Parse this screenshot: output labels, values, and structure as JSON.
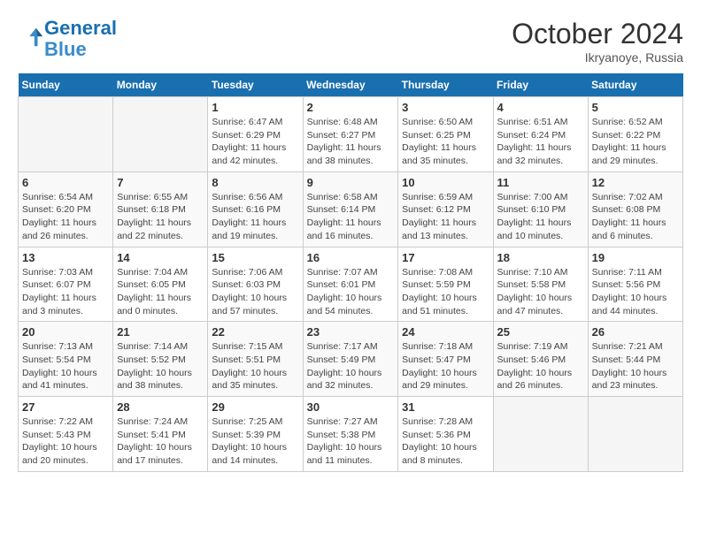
{
  "logo": {
    "line1": "General",
    "line2": "Blue"
  },
  "title": "October 2024",
  "location": "Ikryanoye, Russia",
  "days_header": [
    "Sunday",
    "Monday",
    "Tuesday",
    "Wednesday",
    "Thursday",
    "Friday",
    "Saturday"
  ],
  "weeks": [
    [
      {
        "day": "",
        "info": ""
      },
      {
        "day": "",
        "info": ""
      },
      {
        "day": "1",
        "info": "Sunrise: 6:47 AM\nSunset: 6:29 PM\nDaylight: 11 hours and 42 minutes."
      },
      {
        "day": "2",
        "info": "Sunrise: 6:48 AM\nSunset: 6:27 PM\nDaylight: 11 hours and 38 minutes."
      },
      {
        "day": "3",
        "info": "Sunrise: 6:50 AM\nSunset: 6:25 PM\nDaylight: 11 hours and 35 minutes."
      },
      {
        "day": "4",
        "info": "Sunrise: 6:51 AM\nSunset: 6:24 PM\nDaylight: 11 hours and 32 minutes."
      },
      {
        "day": "5",
        "info": "Sunrise: 6:52 AM\nSunset: 6:22 PM\nDaylight: 11 hours and 29 minutes."
      }
    ],
    [
      {
        "day": "6",
        "info": "Sunrise: 6:54 AM\nSunset: 6:20 PM\nDaylight: 11 hours and 26 minutes."
      },
      {
        "day": "7",
        "info": "Sunrise: 6:55 AM\nSunset: 6:18 PM\nDaylight: 11 hours and 22 minutes."
      },
      {
        "day": "8",
        "info": "Sunrise: 6:56 AM\nSunset: 6:16 PM\nDaylight: 11 hours and 19 minutes."
      },
      {
        "day": "9",
        "info": "Sunrise: 6:58 AM\nSunset: 6:14 PM\nDaylight: 11 hours and 16 minutes."
      },
      {
        "day": "10",
        "info": "Sunrise: 6:59 AM\nSunset: 6:12 PM\nDaylight: 11 hours and 13 minutes."
      },
      {
        "day": "11",
        "info": "Sunrise: 7:00 AM\nSunset: 6:10 PM\nDaylight: 11 hours and 10 minutes."
      },
      {
        "day": "12",
        "info": "Sunrise: 7:02 AM\nSunset: 6:08 PM\nDaylight: 11 hours and 6 minutes."
      }
    ],
    [
      {
        "day": "13",
        "info": "Sunrise: 7:03 AM\nSunset: 6:07 PM\nDaylight: 11 hours and 3 minutes."
      },
      {
        "day": "14",
        "info": "Sunrise: 7:04 AM\nSunset: 6:05 PM\nDaylight: 11 hours and 0 minutes."
      },
      {
        "day": "15",
        "info": "Sunrise: 7:06 AM\nSunset: 6:03 PM\nDaylight: 10 hours and 57 minutes."
      },
      {
        "day": "16",
        "info": "Sunrise: 7:07 AM\nSunset: 6:01 PM\nDaylight: 10 hours and 54 minutes."
      },
      {
        "day": "17",
        "info": "Sunrise: 7:08 AM\nSunset: 5:59 PM\nDaylight: 10 hours and 51 minutes."
      },
      {
        "day": "18",
        "info": "Sunrise: 7:10 AM\nSunset: 5:58 PM\nDaylight: 10 hours and 47 minutes."
      },
      {
        "day": "19",
        "info": "Sunrise: 7:11 AM\nSunset: 5:56 PM\nDaylight: 10 hours and 44 minutes."
      }
    ],
    [
      {
        "day": "20",
        "info": "Sunrise: 7:13 AM\nSunset: 5:54 PM\nDaylight: 10 hours and 41 minutes."
      },
      {
        "day": "21",
        "info": "Sunrise: 7:14 AM\nSunset: 5:52 PM\nDaylight: 10 hours and 38 minutes."
      },
      {
        "day": "22",
        "info": "Sunrise: 7:15 AM\nSunset: 5:51 PM\nDaylight: 10 hours and 35 minutes."
      },
      {
        "day": "23",
        "info": "Sunrise: 7:17 AM\nSunset: 5:49 PM\nDaylight: 10 hours and 32 minutes."
      },
      {
        "day": "24",
        "info": "Sunrise: 7:18 AM\nSunset: 5:47 PM\nDaylight: 10 hours and 29 minutes."
      },
      {
        "day": "25",
        "info": "Sunrise: 7:19 AM\nSunset: 5:46 PM\nDaylight: 10 hours and 26 minutes."
      },
      {
        "day": "26",
        "info": "Sunrise: 7:21 AM\nSunset: 5:44 PM\nDaylight: 10 hours and 23 minutes."
      }
    ],
    [
      {
        "day": "27",
        "info": "Sunrise: 7:22 AM\nSunset: 5:43 PM\nDaylight: 10 hours and 20 minutes."
      },
      {
        "day": "28",
        "info": "Sunrise: 7:24 AM\nSunset: 5:41 PM\nDaylight: 10 hours and 17 minutes."
      },
      {
        "day": "29",
        "info": "Sunrise: 7:25 AM\nSunset: 5:39 PM\nDaylight: 10 hours and 14 minutes."
      },
      {
        "day": "30",
        "info": "Sunrise: 7:27 AM\nSunset: 5:38 PM\nDaylight: 10 hours and 11 minutes."
      },
      {
        "day": "31",
        "info": "Sunrise: 7:28 AM\nSunset: 5:36 PM\nDaylight: 10 hours and 8 minutes."
      },
      {
        "day": "",
        "info": ""
      },
      {
        "day": "",
        "info": ""
      }
    ]
  ]
}
